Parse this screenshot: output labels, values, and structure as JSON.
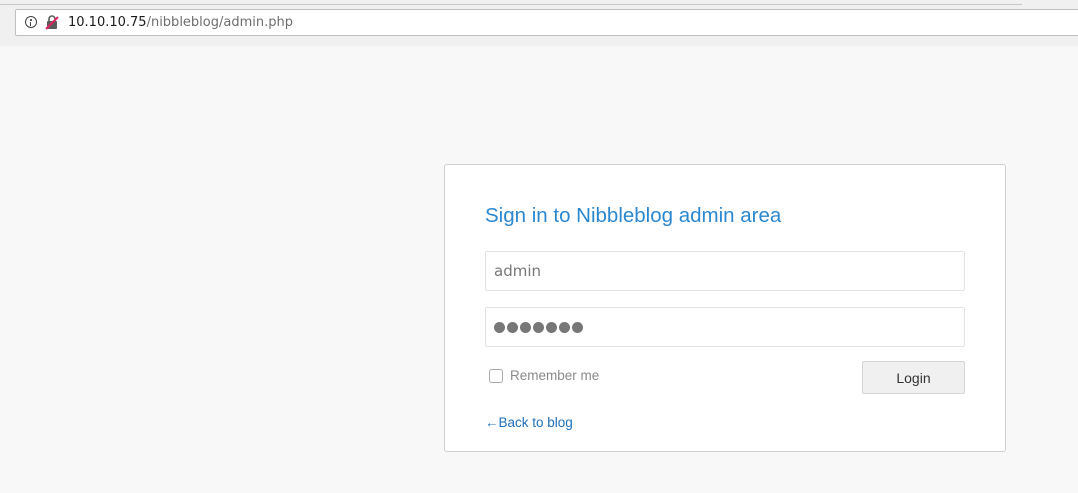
{
  "browser": {
    "url_host": "10.10.10.75",
    "url_path": "/nibbleblog/admin.php",
    "info_icon": "info-icon",
    "lock_icon": "insecure-lock-icon"
  },
  "login": {
    "title": "Sign in to Nibbleblog admin area",
    "username_value": "admin",
    "password_masked_length": 7,
    "remember_label": "Remember me",
    "remember_checked": false,
    "login_button": "Login",
    "back_link": "←Back to blog"
  },
  "colors": {
    "title": "#2b88d0",
    "link": "#1e6fb8",
    "background": "#f8f8f8"
  }
}
